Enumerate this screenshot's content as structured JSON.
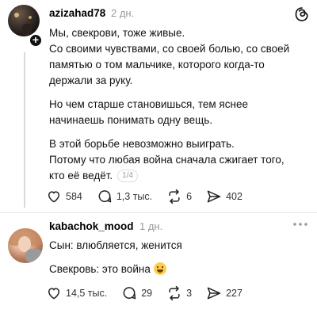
{
  "post1": {
    "username": "azizahad78",
    "timestamp": "2 дн.",
    "lines": [
      "Мы, свекрови, тоже живые.",
      "Со своими чувствами, со своей болью, со своей",
      "памятью о том мальчике, которого когда-то",
      "держали за руку.",
      "Но чем старше становишься, тем яснее",
      "начинаешь понимать одну вещь.",
      "В этой борьбе невозможно выиграть.",
      "Потому что любая война сначала сжигает того,",
      "кто её ведёт."
    ],
    "page_indicator": "1/4",
    "likes": "584",
    "comments": "1,3 тыс.",
    "reposts": "6",
    "shares": "402"
  },
  "post2": {
    "username": "kabachok_mood",
    "timestamp": "1 дн.",
    "lines": [
      "Сын: влюбляется, женится",
      "Свекровь: это война"
    ],
    "likes": "14,5 тыс.",
    "comments": "29",
    "reposts": "3",
    "shares": "227"
  },
  "icons": {
    "app_logo": "threads-icon",
    "follow": "plus-icon",
    "like": "heart-icon",
    "comment": "comment-icon",
    "repost": "repost-icon",
    "share": "send-icon",
    "more": "more-icon",
    "emoji": "grimacing-face-emoji"
  }
}
